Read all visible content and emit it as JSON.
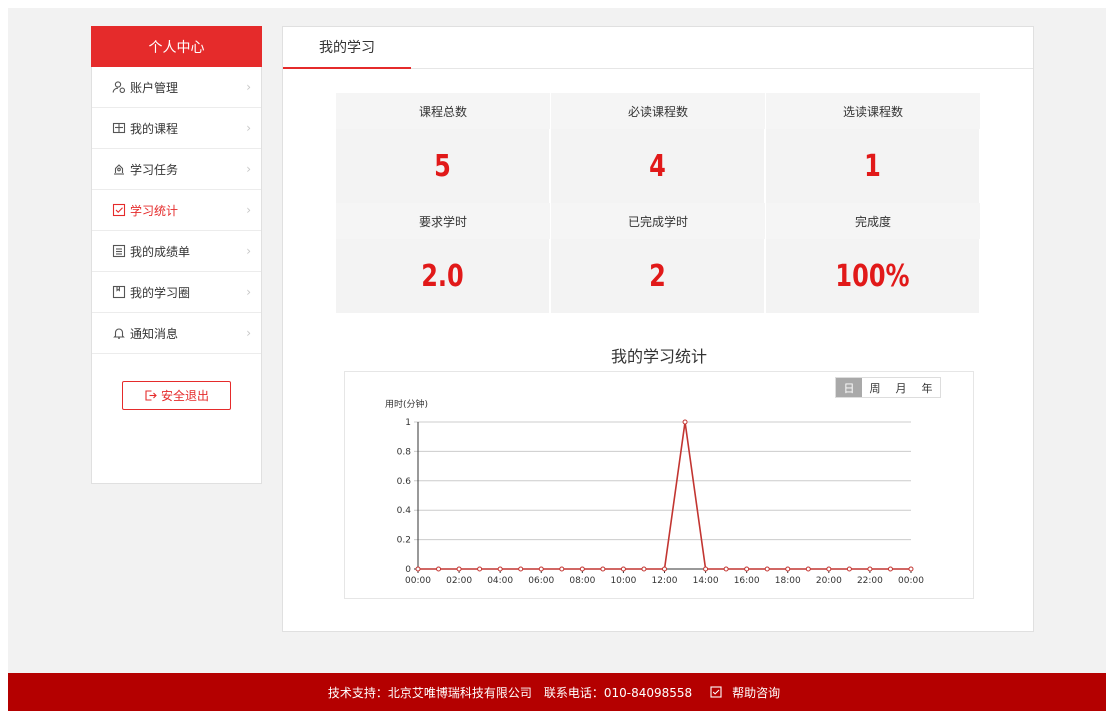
{
  "sidebar": {
    "title": "个人中心",
    "items": [
      {
        "label": "账户管理",
        "icon": "user-account-icon",
        "active": false
      },
      {
        "label": "我的课程",
        "icon": "book-icon",
        "active": false
      },
      {
        "label": "学习任务",
        "icon": "task-icon",
        "active": false
      },
      {
        "label": "学习统计",
        "icon": "checkbox-icon",
        "active": true
      },
      {
        "label": "我的成绩单",
        "icon": "report-card-icon",
        "active": false
      },
      {
        "label": "我的学习圈",
        "icon": "notebook-icon",
        "active": false
      },
      {
        "label": "通知消息",
        "icon": "bell-icon",
        "active": false
      }
    ],
    "logout_label": "安全退出"
  },
  "main": {
    "tab_label": "我的学习",
    "stats": [
      {
        "label": "课程总数",
        "value": "5"
      },
      {
        "label": "必读课程数",
        "value": "4"
      },
      {
        "label": "选读课程数",
        "value": "1"
      },
      {
        "label": "要求学时",
        "value": "2.0"
      },
      {
        "label": "已完成学时",
        "value": "2"
      },
      {
        "label": "完成度",
        "value": "100%"
      }
    ],
    "chart_title": "我的学习统计",
    "range_tabs": [
      "日",
      "周",
      "月",
      "年"
    ],
    "active_range": "日"
  },
  "chart_data": {
    "type": "line",
    "title": "我的学习统计",
    "ylabel": "用时(分钟)",
    "xlabel": "",
    "ylim": [
      0,
      1
    ],
    "yticks": [
      "0",
      "0.2",
      "0.4",
      "0.6",
      "0.8",
      "1"
    ],
    "categories": [
      "00:00",
      "01:00",
      "02:00",
      "03:00",
      "04:00",
      "05:00",
      "06:00",
      "07:00",
      "08:00",
      "09:00",
      "10:00",
      "11:00",
      "12:00",
      "13:00",
      "14:00",
      "15:00",
      "16:00",
      "17:00",
      "18:00",
      "19:00",
      "20:00",
      "21:00",
      "22:00",
      "23:00",
      "00:00"
    ],
    "xticklabels": [
      "00:00",
      "02:00",
      "04:00",
      "06:00",
      "08:00",
      "10:00",
      "12:00",
      "14:00",
      "16:00",
      "18:00",
      "20:00",
      "22:00",
      "00:00"
    ],
    "series": [
      {
        "values": [
          0,
          0,
          0,
          0,
          0,
          0,
          0,
          0,
          0,
          0,
          0,
          0,
          0,
          1,
          0,
          0,
          0,
          0,
          0,
          0,
          0,
          0,
          0,
          0,
          0
        ],
        "color": "#c23531"
      }
    ],
    "grid": true
  },
  "footer": {
    "support": "技术支持：北京艾唯博瑞科技有限公司",
    "phone": "联系电话：010-84098558",
    "help": "帮助咨询"
  },
  "colors": {
    "accent": "#e52b2b",
    "footer": "#b40000",
    "value": "#e11919"
  }
}
